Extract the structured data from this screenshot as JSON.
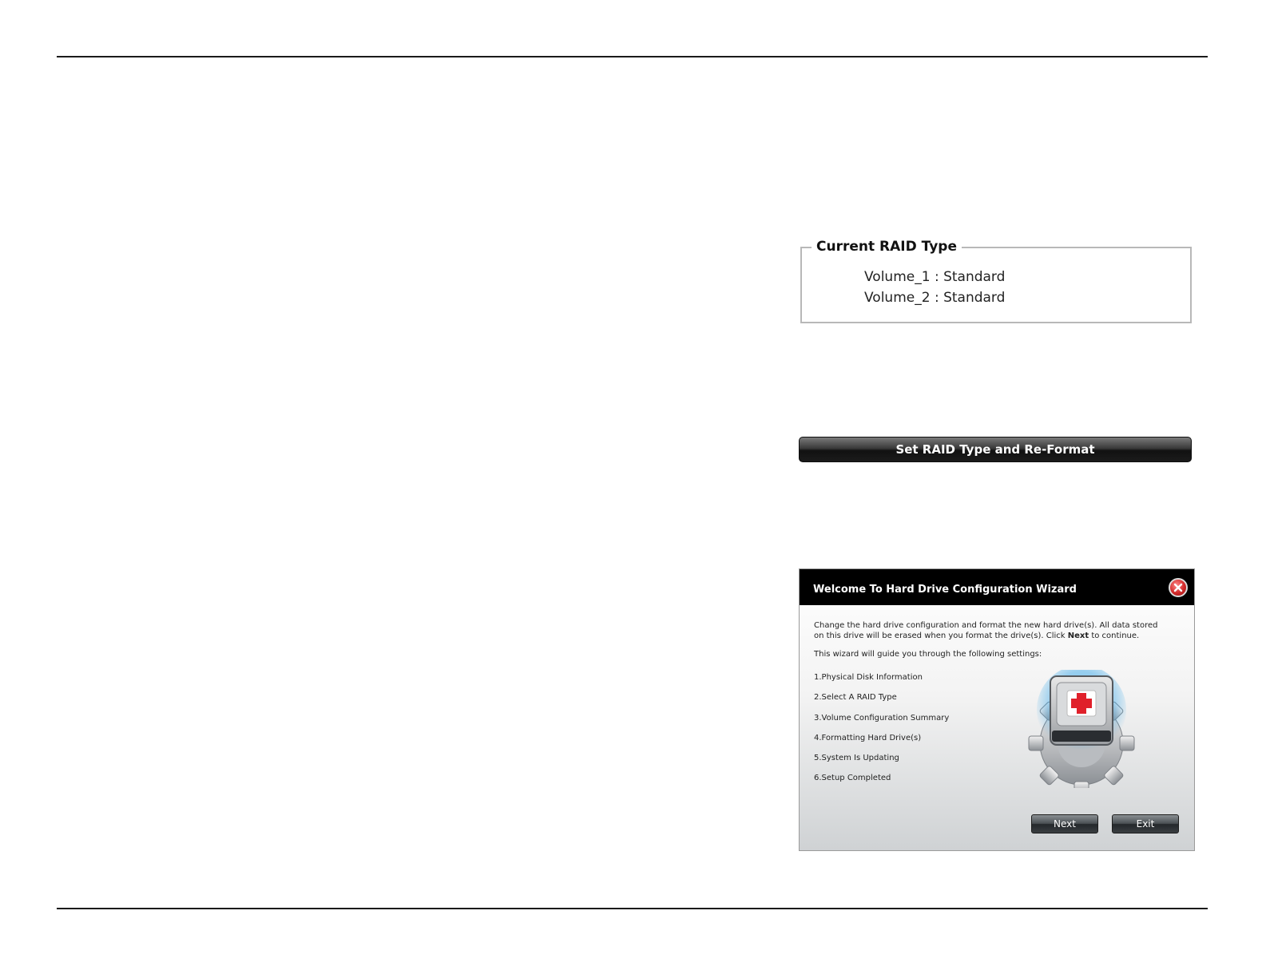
{
  "raid": {
    "legend": "Current RAID Type",
    "volumes": [
      {
        "label": "Volume_1 : Standard"
      },
      {
        "label": "Volume_2 : Standard"
      }
    ]
  },
  "set_raid_button": "Set RAID Type and Re-Format",
  "wizard": {
    "title": "Welcome To Hard Drive Configuration Wizard",
    "intro_part1": "Change the hard drive configuration and format the new hard drive(s). All data stored on this drive will be erased when you format the drive(s). Click ",
    "intro_bold": "Next",
    "intro_part2": " to continue.",
    "guide": "This wizard will guide you through the following settings:",
    "steps": [
      "1.Physical Disk Information",
      "2.Select A RAID Type",
      "3.Volume Configuration Summary",
      "4.Formatting Hard Drive(s)",
      "5.System Is Updating",
      "6.Setup Completed"
    ],
    "next_label": "Next",
    "exit_label": "Exit",
    "icons": {
      "close": "close-icon",
      "graphic": "hard-drive-gear-icon"
    }
  },
  "colors": {
    "header": "#000000",
    "close": "#d32a2a",
    "cross": "#e0202a"
  }
}
